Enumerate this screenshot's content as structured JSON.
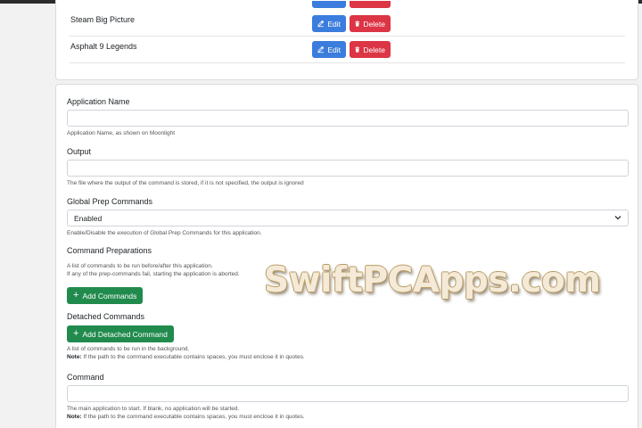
{
  "apps": [
    {
      "name": "Steam Big Picture",
      "edit_label": "Edit",
      "delete_label": "Delete"
    },
    {
      "name": "Asphalt 9 Legends",
      "edit_label": "Edit",
      "delete_label": "Delete"
    }
  ],
  "form": {
    "app_name": {
      "label": "Application Name",
      "value": "",
      "help": "Application Name, as shown on Moonlight"
    },
    "output": {
      "label": "Output",
      "value": "",
      "help": "The file where the output of the command is stored, if it is not specified, the output is ignored"
    },
    "global_prep": {
      "label": "Global Prep Commands",
      "selected": "Enabled",
      "help": "Enable/Disable the execution of Global Prep Commands for this application."
    },
    "command_preparations": {
      "label": "Command Preparations",
      "help_line1": "A list of commands to be run before/after this application.",
      "help_line2": "If any of the prep-commands fail, starting the application is aborted.",
      "add_button": "Add Commands"
    },
    "detached_commands": {
      "label": "Detached Commands",
      "add_button": "Add Detached Command",
      "help_line1": "A list of commands to be run in the background.",
      "note_label": "Note:",
      "note_text": " If the path to the command executable contains spaces, you must enclose it in quotes."
    },
    "command": {
      "label": "Command",
      "value": "",
      "help_line1": "The main application to start. If blank, no application will be started.",
      "note_label": "Note:",
      "note_text": " If the path to the command executable contains spaces, you must enclose it in quotes."
    }
  },
  "watermark": "SwiftPCApps.com",
  "colors": {
    "primary": "#3b7ddd",
    "danger": "#dc3545",
    "success": "#218b4d"
  }
}
